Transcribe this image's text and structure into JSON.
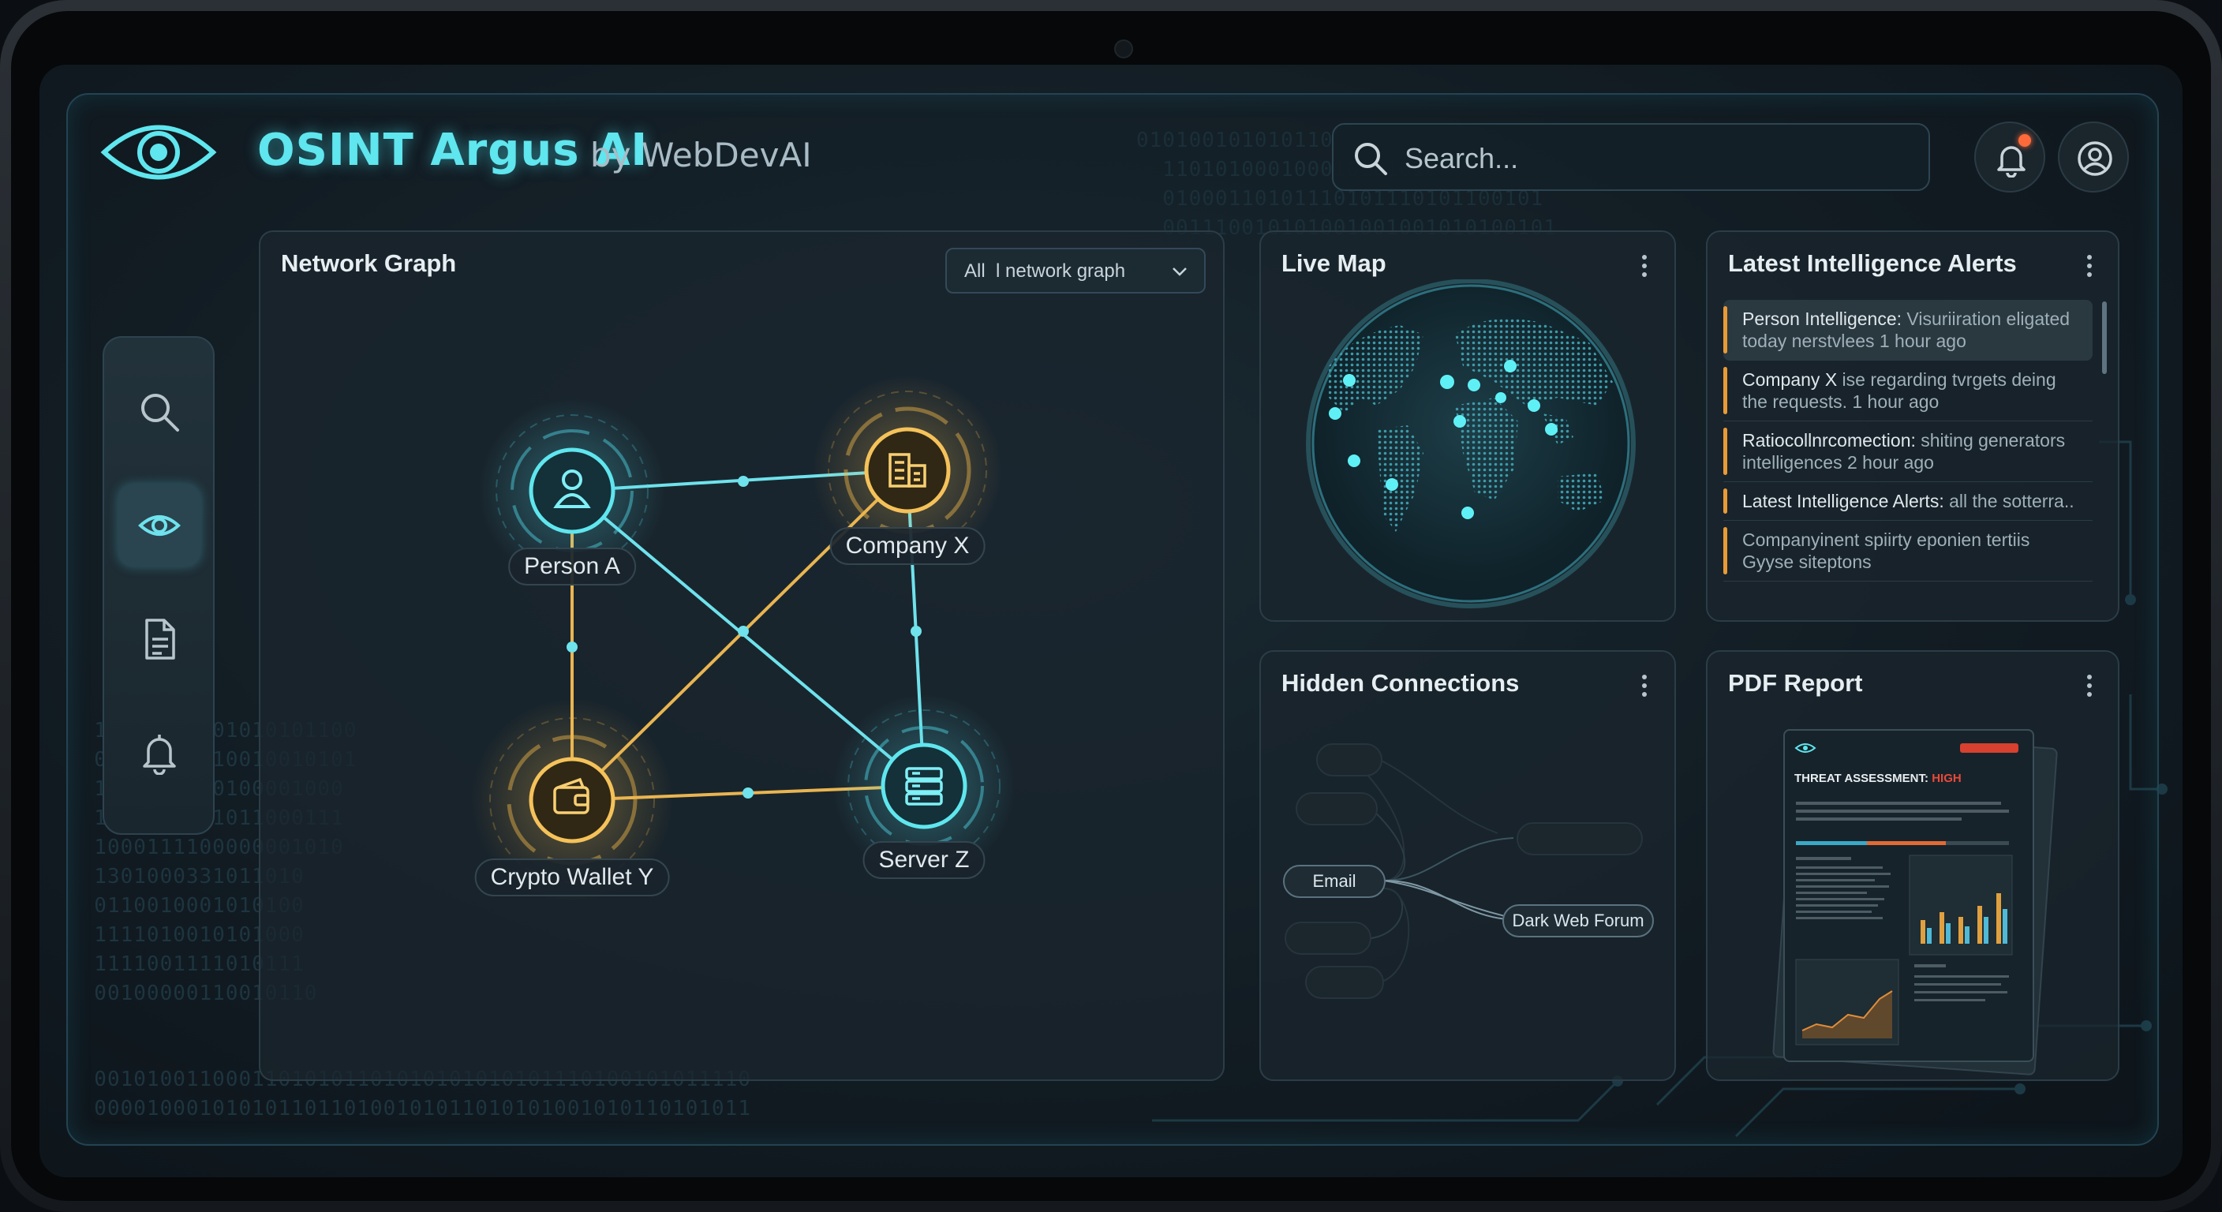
{
  "app": {
    "title": "OSINT Argus AI",
    "subtitle": "by WebDevAI"
  },
  "search": {
    "placeholder": "Search..."
  },
  "header_icons": [
    "bell-icon",
    "user-account-icon"
  ],
  "sidebar": {
    "items": [
      {
        "icon": "search-icon",
        "active": false
      },
      {
        "icon": "eye-icon",
        "active": true
      },
      {
        "icon": "document-icon",
        "active": false
      },
      {
        "icon": "bell-icon",
        "active": false
      }
    ]
  },
  "network_graph": {
    "title": "Network Graph",
    "filter": "All  l network graph",
    "nodes": [
      {
        "id": "person",
        "label": "Person A",
        "icon": "person-icon",
        "color": "#4fd8e6"
      },
      {
        "id": "company",
        "label": "Company X",
        "icon": "building-icon",
        "color": "#f0b54a"
      },
      {
        "id": "wallet",
        "label": "Crypto Wallet Y",
        "icon": "wallet-icon",
        "color": "#f0b54a"
      },
      {
        "id": "server",
        "label": "Server Z",
        "icon": "server-icon",
        "color": "#4fd8e6"
      }
    ],
    "edges": [
      [
        "person",
        "company"
      ],
      [
        "person",
        "wallet"
      ],
      [
        "person",
        "server"
      ],
      [
        "company",
        "wallet"
      ],
      [
        "company",
        "server"
      ],
      [
        "wallet",
        "server"
      ]
    ]
  },
  "live_map": {
    "title": "Live Map"
  },
  "alerts": {
    "title": "Latest Intelligence Alerts",
    "items": [
      {
        "head": "Person Intelligence:",
        "body": " Visuriiration eligated today nerstvlees",
        "time": " 1 hour ago"
      },
      {
        "head": "Company X",
        "body": " ise regarding tvrgets deing the requests.",
        "time": " 1 hour ago"
      },
      {
        "head": "Ratiocollnrcomection:",
        "body": " shiting generators intelligences",
        "time": " 2 hour ago"
      },
      {
        "head": "Latest Intelligence Alerts:",
        "body": " all the sotterra..",
        "time": ""
      },
      {
        "head": "Companyinent spiirty eponien tertiis",
        "body": " Gyyse siteptons",
        "time": ""
      }
    ]
  },
  "hidden_connections": {
    "title": "Hidden Connections",
    "source": "Email",
    "target": "Dark Web Forum"
  },
  "pdf_report": {
    "title": "PDF Report",
    "doc_title": "THREAT ASSESSMENT:",
    "doc_level": "HIGH",
    "level_color": "#e84a3a"
  },
  "colors": {
    "accent": "#4fd8e6",
    "amber": "#f0b54a",
    "alert": "#e99a37"
  }
}
